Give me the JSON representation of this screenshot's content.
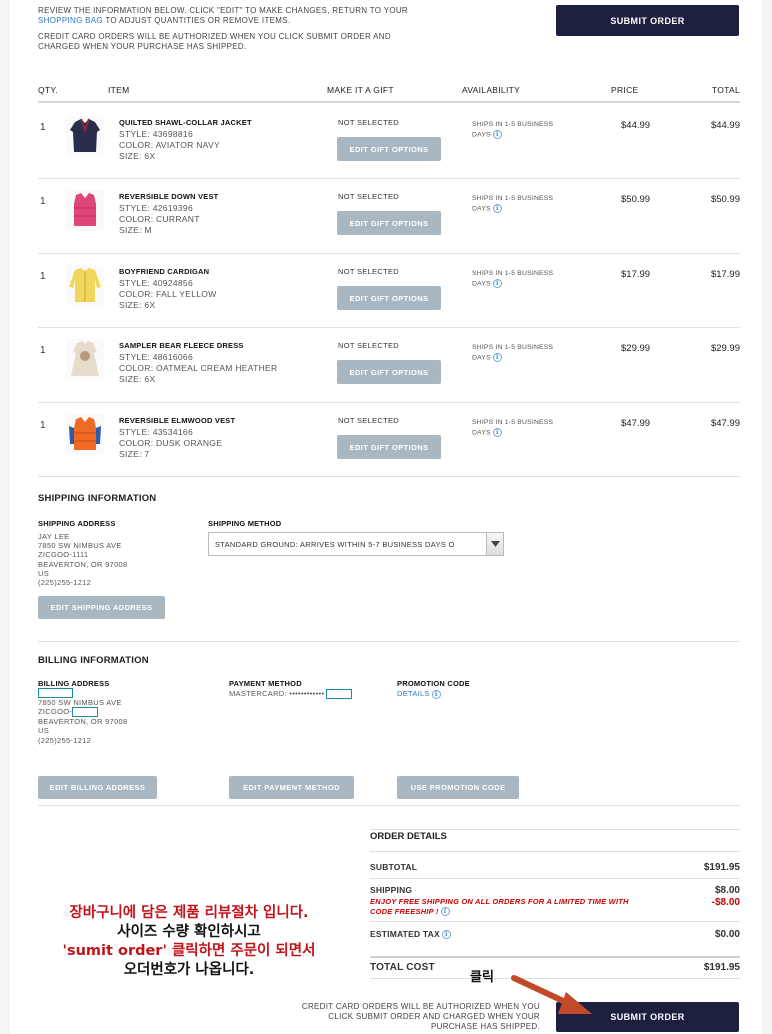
{
  "top": {
    "review_line1": "REVIEW THE INFORMATION BELOW. CLICK \"EDIT\" TO MAKE CHANGES, RETURN TO YOUR",
    "shopping_bag_link": "SHOPPING BAG",
    "review_line2_rest": "TO ADJUST QUANTITIES OR REMOVE ITEMS.",
    "cc_note_line1": "CREDIT CARD ORDERS WILL BE AUTHORIZED WHEN YOU CLICK SUBMIT ORDER AND",
    "cc_note_line2": "CHARGED WHEN YOUR PURCHASE HAS SHIPPED.",
    "submit_label": "SUBMIT ORDER"
  },
  "table": {
    "headers": {
      "qty": "QTY.",
      "item": "ITEM",
      "gift": "MAKE IT A GIFT",
      "availability": "AVAILABILITY",
      "price": "PRICE",
      "total": "TOTAL"
    },
    "items": [
      {
        "qty": "1",
        "name": "QUILTED SHAWL-COLLAR JACKET",
        "style": "STYLE: 43698816",
        "color": "COLOR: AVIATOR NAVY",
        "size": "SIZE: 6X",
        "gift_status": "NOT SELECTED",
        "gift_button": "EDIT GIFT OPTIONS",
        "avail_line1": "SHIPS IN 1-5 BUSINESS",
        "avail_line2": "DAYS",
        "price": "$44.99",
        "total": "$44.99",
        "thumb_color": "#2a2e4a"
      },
      {
        "qty": "1",
        "name": "REVERSIBLE DOWN VEST",
        "style": "STYLE: 42619396",
        "color": "COLOR: CURRANT",
        "size": "SIZE: M",
        "gift_status": "NOT SELECTED",
        "gift_button": "EDIT GIFT OPTIONS",
        "avail_line1": "SHIPS IN 1-5 BUSINESS",
        "avail_line2": "DAYS",
        "price": "$50.99",
        "total": "$50.99",
        "thumb_color": "#e0457a"
      },
      {
        "qty": "1",
        "name": "BOYFRIEND CARDIGAN",
        "style": "STYLE: 40924856",
        "color": "COLOR: FALL YELLOW",
        "size": "SIZE: 6X",
        "gift_status": "NOT SELECTED",
        "gift_button": "EDIT GIFT OPTIONS",
        "avail_line1": "SHIPS IN 1-5 BUSINESS",
        "avail_line2": "DAYS",
        "price": "$17.99",
        "total": "$17.99",
        "thumb_color": "#f0d65a"
      },
      {
        "qty": "1",
        "name": "SAMPLER BEAR FLEECE DRESS",
        "style": "STYLE: 48616066",
        "color": "COLOR: OATMEAL CREAM HEATHER",
        "size": "SIZE: 6X",
        "gift_status": "NOT SELECTED",
        "gift_button": "EDIT GIFT OPTIONS",
        "avail_line1": "SHIPS IN 1-5 BUSINESS",
        "avail_line2": "DAYS",
        "price": "$29.99",
        "total": "$29.99",
        "thumb_color": "#e6dccb"
      },
      {
        "qty": "1",
        "name": "REVERSIBLE ELMWOOD VEST",
        "style": "STYLE: 43534166",
        "color": "COLOR: DUSK ORANGE",
        "size": "SIZE: 7",
        "gift_status": "NOT SELECTED",
        "gift_button": "EDIT GIFT OPTIONS",
        "avail_line1": "SHIPS IN 1-5 BUSINESS",
        "avail_line2": "DAYS",
        "price": "$47.99",
        "total": "$47.99",
        "thumb_color": "#ef6a24"
      }
    ]
  },
  "shipping": {
    "title": "SHIPPING INFORMATION",
    "address_title": "SHIPPING ADDRESS",
    "address_lines": [
      "JAY LEE",
      "7850 SW NIMBUS AVE",
      "ZICGOO-1111",
      "BEAVERTON, OR 97008",
      "US",
      "(225)255-1212"
    ],
    "method_title": "SHIPPING METHOD",
    "method_value": "STANDARD GROUND: ARRIVES WITHIN 5-7 BUSINESS DAYS O",
    "edit_button": "EDIT SHIPPING ADDRESS"
  },
  "billing": {
    "title": "BILLING INFORMATION",
    "address_title": "BILLING ADDRESS",
    "address_line2": "7850 SW NIMBUS AVE",
    "address_line3_prefix": "ZICGOO-",
    "address_line4": "BEAVERTON, OR 97008",
    "address_line5": "US",
    "address_line6": "(225)255-1212",
    "payment_title": "PAYMENT METHOD",
    "payment_value": "MASTERCARD: ••••••••••••",
    "promo_title": "PROMOTION CODE",
    "promo_link": "DETAILS",
    "edit_billing": "EDIT BILLING ADDRESS",
    "edit_payment": "EDIT PAYMENT METHOD",
    "use_promo": "USE PROMOTION CODE"
  },
  "order_details": {
    "title": "ORDER DETAILS",
    "subtotal_label": "SUBTOTAL",
    "subtotal_value": "$191.95",
    "shipping_label": "SHIPPING",
    "shipping_value": "$8.00",
    "promo_line1": "ENJOY FREE SHIPPING ON ALL ORDERS FOR A LIMITED TIME WITH",
    "promo_line2": "CODE FREESHIP !",
    "promo_discount": "-$8.00",
    "tax_label": "ESTIMATED TAX",
    "tax_value": "$0.00",
    "total_label": "TOTAL COST",
    "total_value": "$191.95"
  },
  "bottom": {
    "cc_line1": "CREDIT CARD ORDERS WILL BE AUTHORIZED WHEN YOU",
    "cc_line2": "CLICK SUBMIT ORDER AND CHARGED WHEN YOUR",
    "cc_line3": "PURCHASE HAS SHIPPED.",
    "submit_label": "SUBMIT ORDER"
  },
  "annotation": {
    "line1": "장바구니에 담은 제품 리뷰절차 입니다.",
    "line2": "사이즈 수량 확인하시고",
    "line3": "'sumit order' 클릭하면 주문이 되면서",
    "line4": "오더번호가 나옵니다.",
    "click_label": "클릭",
    "arrow_color": "#c24a2a",
    "text_red": "#c0141a"
  },
  "colors": {
    "dark_button": "#1d1f3f",
    "gray_button": "#a9b7c2",
    "link_blue": "#2f79c0",
    "promo_red": "#cc0000"
  }
}
